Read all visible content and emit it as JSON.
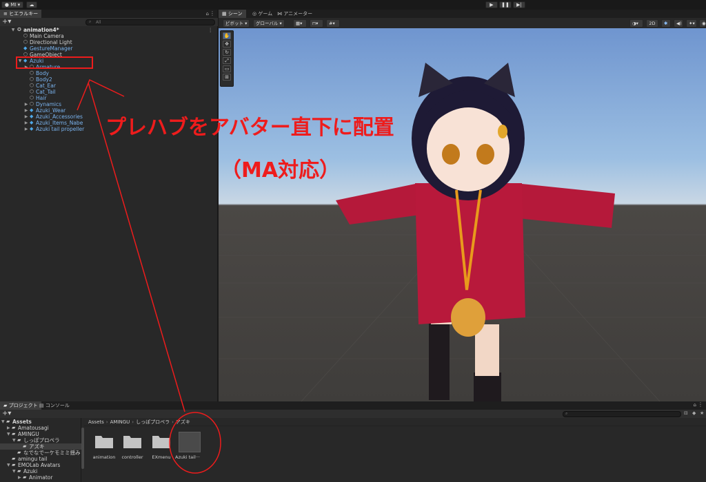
{
  "toolbar": {
    "account_label": "MI ▾",
    "cloud_icon": "cloud-icon",
    "play_icon": "play-icon",
    "pause_icon": "pause-icon",
    "step_icon": "step-icon"
  },
  "hierarchy": {
    "tab_label": "ヒエラルキー",
    "search_placeholder": "All",
    "scene_name": "animation4*",
    "items": [
      {
        "label": "Main Camera",
        "type": "plain",
        "depth": 1,
        "icon": "cube-icon"
      },
      {
        "label": "Directional Light",
        "type": "plain",
        "depth": 1,
        "icon": "cube-icon"
      },
      {
        "label": "GestureManager",
        "type": "prefab",
        "depth": 1,
        "icon": "prefab-icon"
      },
      {
        "label": "GameObject",
        "type": "plain",
        "depth": 1,
        "icon": "cube-icon"
      },
      {
        "label": "Azuki",
        "type": "prefab",
        "depth": 1,
        "icon": "prefab-icon",
        "arrow": "▼"
      },
      {
        "label": "Armature",
        "type": "prefab",
        "depth": 2,
        "icon": "cube-icon",
        "arrow": "▶"
      },
      {
        "label": "Body",
        "type": "prefab",
        "depth": 2,
        "icon": "cube-icon"
      },
      {
        "label": "Body2",
        "type": "prefab",
        "depth": 2,
        "icon": "cube-icon"
      },
      {
        "label": "Cat_Ear",
        "type": "prefab",
        "depth": 2,
        "icon": "cube-icon"
      },
      {
        "label": "Cat_Tail",
        "type": "prefab",
        "depth": 2,
        "icon": "cube-icon"
      },
      {
        "label": "Hair",
        "type": "prefab",
        "depth": 2,
        "icon": "cube-icon"
      },
      {
        "label": "Dynamics",
        "type": "prefab",
        "depth": 2,
        "icon": "cube-icon",
        "arrow": "▶"
      },
      {
        "label": "Azuki_Wear",
        "type": "prefab",
        "depth": 2,
        "icon": "prefab-icon",
        "arrow": "▶"
      },
      {
        "label": "Azuki_Accessories",
        "type": "prefab",
        "depth": 2,
        "icon": "prefab-icon",
        "arrow": "▶"
      },
      {
        "label": "Azuki_Items_Nabe",
        "type": "prefab",
        "depth": 2,
        "icon": "prefab-icon",
        "arrow": "▶"
      },
      {
        "label": "Azuki tail propeller",
        "type": "prefab",
        "depth": 2,
        "icon": "prefab-icon",
        "arrow": "▶"
      }
    ]
  },
  "scene": {
    "tabs": [
      {
        "label": "シーン",
        "icon": "grid-icon"
      },
      {
        "label": "ゲーム",
        "icon": "gamepad-icon"
      },
      {
        "label": "アニメーター",
        "icon": "animator-icon"
      }
    ],
    "pivot_label": "ピボット ▾",
    "global_label": "グローバル ▾",
    "mode_2d": "2D"
  },
  "project": {
    "tabs": [
      {
        "label": "プロジェクト",
        "icon": "folder-icon"
      },
      {
        "label": "コンソール",
        "icon": "console-icon"
      }
    ],
    "tree": [
      {
        "label": "Assets",
        "depth": 0,
        "arrow": "▼",
        "bold": true
      },
      {
        "label": "Amatousagi",
        "depth": 1,
        "arrow": "▶"
      },
      {
        "label": "AMINGU",
        "depth": 1,
        "arrow": "▼"
      },
      {
        "label": "しっぽプロペラ",
        "depth": 2,
        "arrow": "▼"
      },
      {
        "label": "アズキ",
        "depth": 3,
        "arrow": "",
        "selected": true
      },
      {
        "label": "なでなでーケモミミ揺み",
        "depth": 2,
        "arrow": ""
      },
      {
        "label": "amingu tail",
        "depth": 1,
        "arrow": ""
      },
      {
        "label": "EMOLab Avatars",
        "depth": 1,
        "arrow": "▼"
      },
      {
        "label": "Azuki",
        "depth": 2,
        "arrow": "▼"
      },
      {
        "label": "Animator",
        "depth": 3,
        "arrow": "▶"
      }
    ],
    "breadcrumb": [
      "Assets",
      "AMINGU",
      "しっぽプロペラ",
      "アズキ"
    ],
    "files": [
      {
        "label": "animation",
        "kind": "folder"
      },
      {
        "label": "controller",
        "kind": "folder"
      },
      {
        "label": "EXmenu",
        "kind": "folder"
      },
      {
        "label": "Azuki tail···",
        "kind": "prefab"
      }
    ]
  },
  "annotation": {
    "line1": "プレハブをアバター直下に配置",
    "line2": "（MA対応）",
    "color": "#ee1c1c"
  }
}
